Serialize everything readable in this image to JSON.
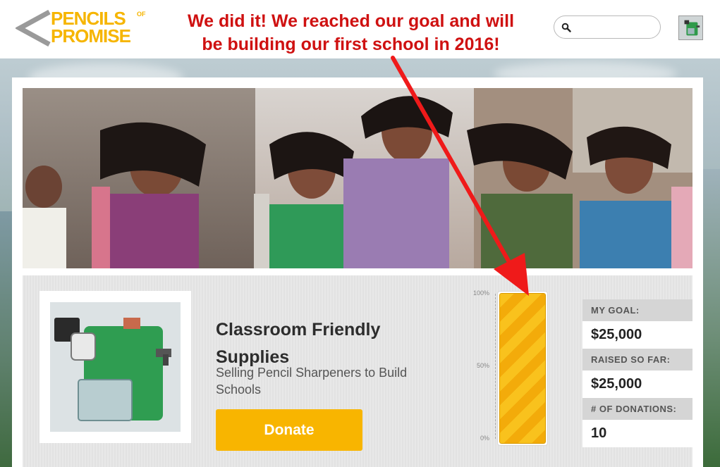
{
  "header": {
    "logo_line1": "PENCILS",
    "logo_line2": "PROMISE",
    "logo_of": "OF",
    "search_placeholder": "",
    "colors": {
      "brand_yellow": "#f6b500",
      "annotation_red": "#cf1111"
    }
  },
  "annotation": {
    "line1": "We did it! We reached our goal and will",
    "line2": "be building our first school in 2016!"
  },
  "project": {
    "title": "Classroom Friendly Supplies",
    "subtitle": "Selling Pencil Sharpeners to Build Schools",
    "donate_label": "Donate",
    "progress_fraction": 1.0,
    "scale": {
      "top": "100%",
      "mid": "50%",
      "bottom": "0%"
    }
  },
  "stats": {
    "goal_label": "MY GOAL:",
    "goal_value": "$25,000",
    "raised_label": "RAISED SO FAR:",
    "raised_value": "$25,000",
    "donations_label": "# OF DONATIONS:",
    "donations_value": "10"
  },
  "icons": [
    "logo-chevron-icon",
    "search-icon",
    "user-avatar",
    "pencil-sharpener-image",
    "hero-photo"
  ]
}
